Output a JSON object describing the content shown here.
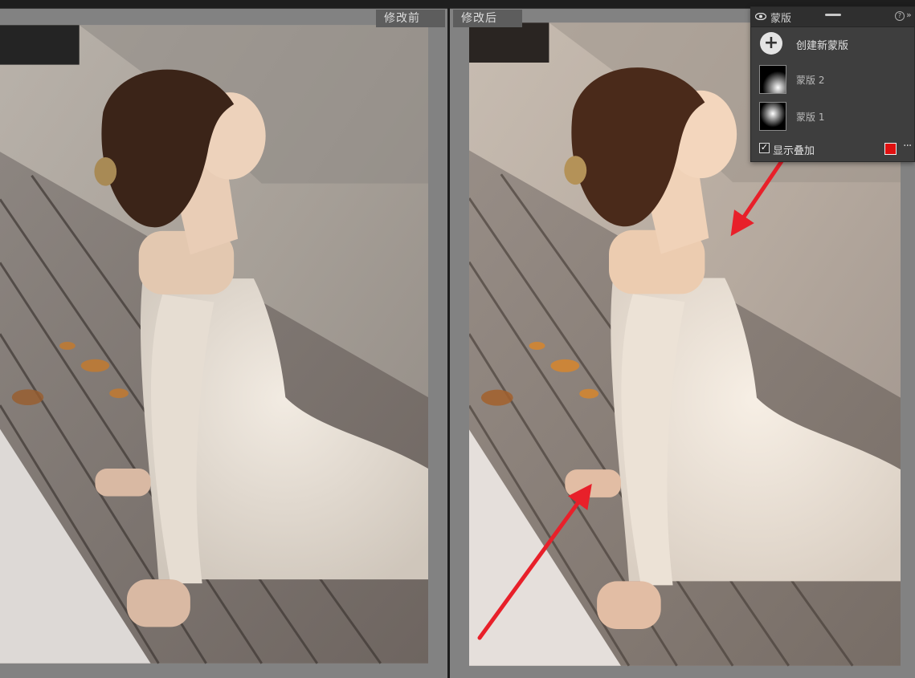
{
  "view": {
    "before_label": "修改前",
    "after_label": "修改后"
  },
  "mask_panel": {
    "title": "蒙版",
    "create_label": "创建新蒙版",
    "masks": [
      {
        "label": "蒙版 2",
        "icon": "mask-thumbnail-icon"
      },
      {
        "label": "蒙版 1",
        "icon": "mask-thumbnail-icon"
      }
    ],
    "overlay_label": "显示叠加",
    "overlay_checked": true,
    "overlay_color": "#e01010"
  },
  "annotations": {
    "arrow_color": "#e8202a"
  }
}
